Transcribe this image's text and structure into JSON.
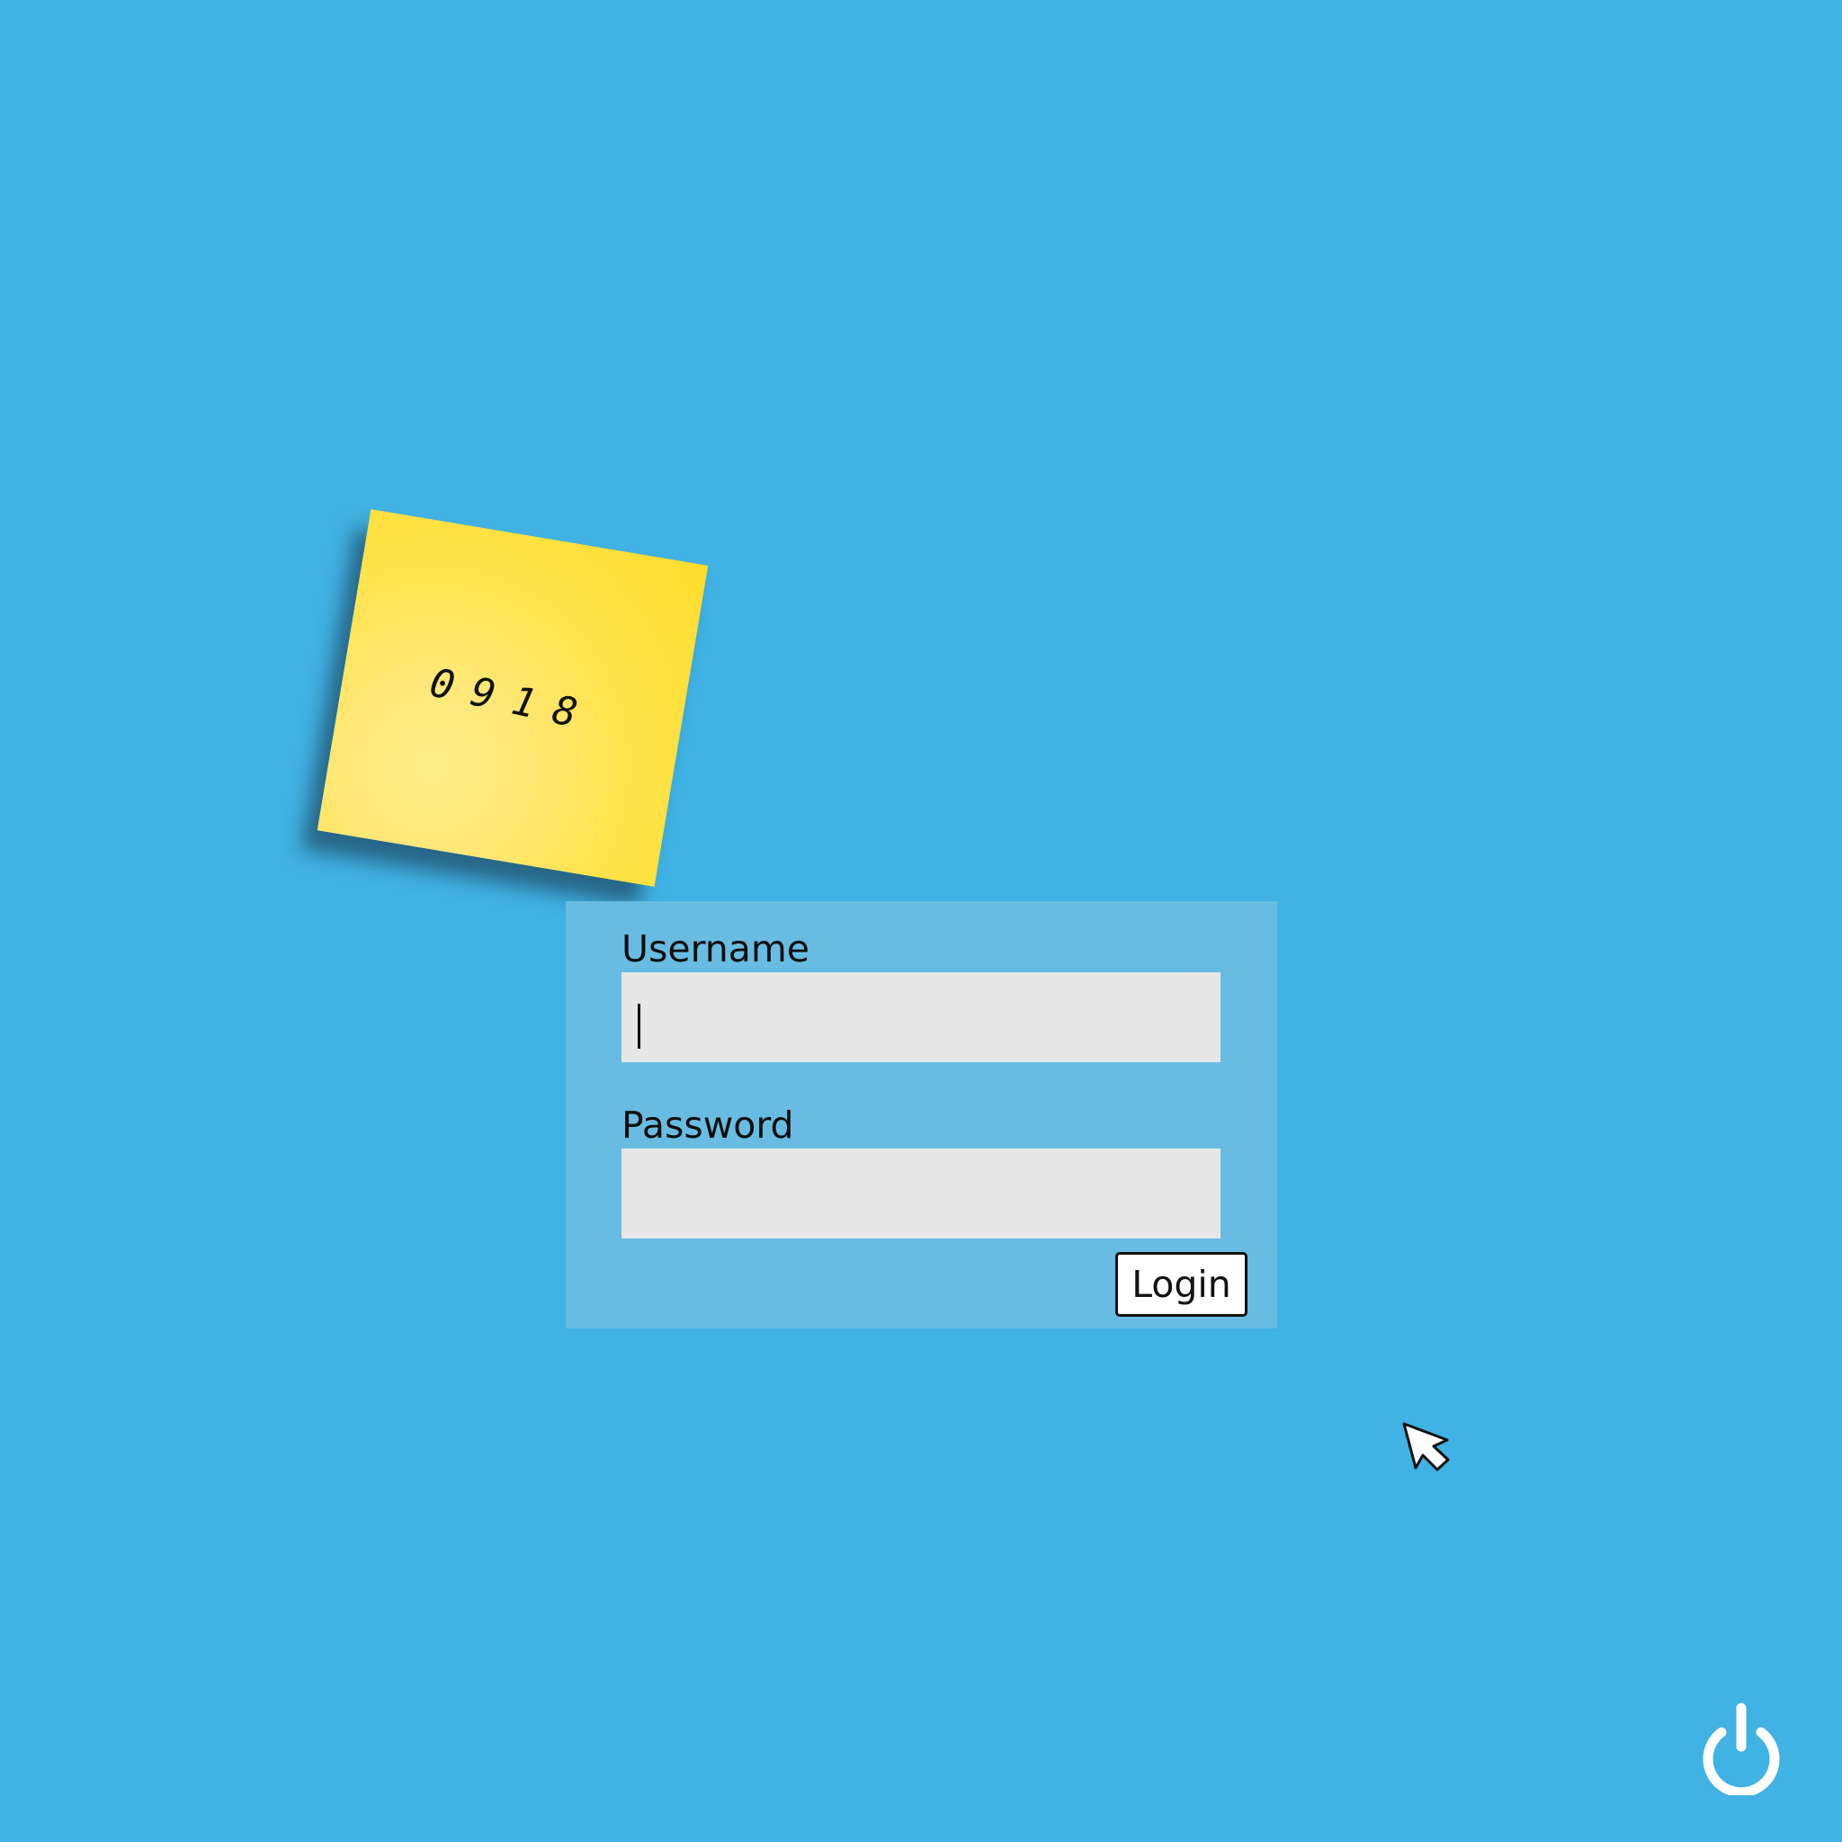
{
  "sticky_note": {
    "text": "0918"
  },
  "login_form": {
    "username_label": "Username",
    "username_value": "",
    "password_label": "Password",
    "password_value": "",
    "login_button_label": "Login"
  },
  "system": {
    "power_icon": "power-icon",
    "cursor_icon": "mouse-pointer-icon"
  },
  "colors": {
    "background": "#40b2e3",
    "panel": "#68bce2",
    "input": "#e7e7e7",
    "sticky_note": "#fee34a"
  }
}
